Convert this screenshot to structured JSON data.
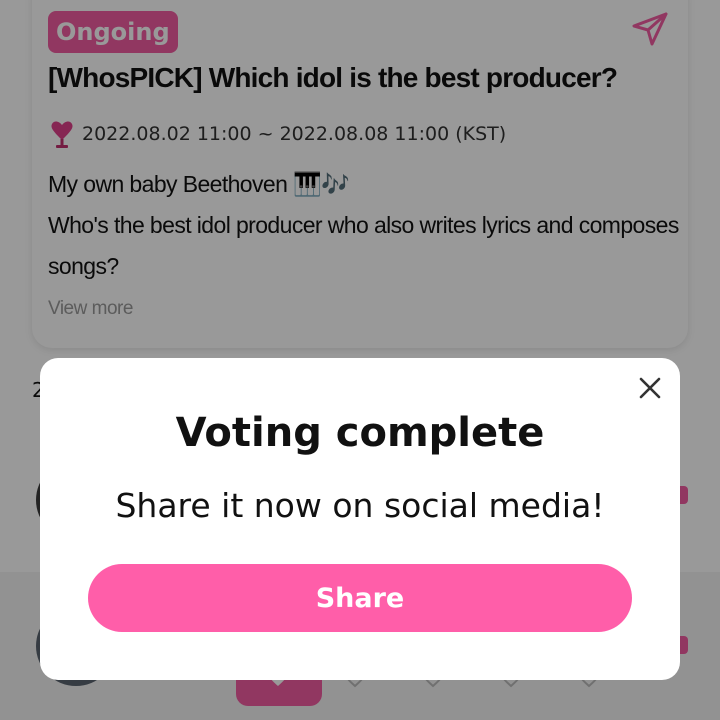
{
  "poll": {
    "status_badge": "Ongoing",
    "title": "[WhosPICK] Which idol is the best producer?",
    "period": "2022.08.02 11:00 ~ 2022.08.08 11:00 (KST)",
    "description_line1": "My own baby Beethoven 🎹🎶",
    "description_line2": "Who's the best idol producer who also writes lyrics and composes",
    "description_line3": "songs?",
    "view_more_label": "View more",
    "ranking_count_partial": "2"
  },
  "icons": {
    "share": "send-icon",
    "period": "trophy-icon",
    "close": "close-icon",
    "vote": "heart-icon"
  },
  "modal": {
    "title": "Voting complete",
    "subtitle": "Share it now on social media!",
    "share_label": "Share"
  },
  "colors": {
    "accent": "#f25ca2",
    "share_button": "#ff5ea9",
    "overlay": "rgba(0,0,0,0.40)",
    "text": "#111111",
    "muted": "#999999"
  }
}
